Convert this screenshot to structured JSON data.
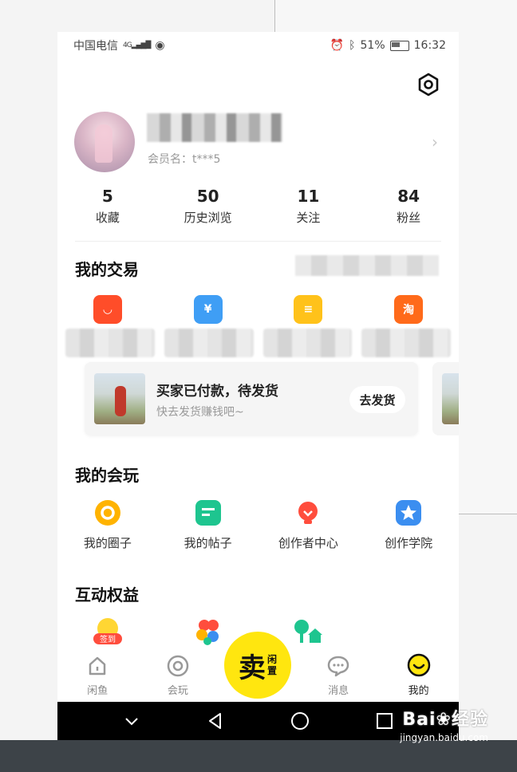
{
  "window": {
    "minimize_glyph": "—",
    "maximize_glyph": "☐",
    "close_glyph": "✕"
  },
  "status_bar": {
    "carrier": "中国电信",
    "network": "4G",
    "battery": "51%",
    "time": "16:32"
  },
  "profile": {
    "member_label": "会员名：t***5",
    "arrow_glyph": "›"
  },
  "stats": [
    {
      "value": "5",
      "label": "收藏"
    },
    {
      "value": "50",
      "label": "历史浏览"
    },
    {
      "value": "11",
      "label": "关注"
    },
    {
      "value": "84",
      "label": "粉丝"
    }
  ],
  "trade": {
    "title": "我的交易",
    "icons": [
      {
        "name": "bag-icon",
        "color": "#ff4d29",
        "glyph": "◡"
      },
      {
        "name": "yuan-icon",
        "color": "#3f9ef5",
        "glyph": "¥"
      },
      {
        "name": "note-icon",
        "color": "#ffc21a",
        "glyph": "≡"
      },
      {
        "name": "box-icon",
        "color": "#ff6a1a",
        "glyph": "淘"
      }
    ]
  },
  "order_card": {
    "title": "买家已付款，待发货",
    "subtitle": "快去发货赚钱吧~",
    "button": "去发货"
  },
  "play": {
    "title": "我的会玩",
    "items": [
      {
        "label": "我的圈子",
        "icon": "circle-icon",
        "color": "#ffb300"
      },
      {
        "label": "我的帖子",
        "icon": "post-icon",
        "color": "#1ec58f"
      },
      {
        "label": "创作者中心",
        "icon": "bulb-icon",
        "color": "#ff4d3d"
      },
      {
        "label": "创作学院",
        "icon": "star-icon",
        "color": "#3b8ef0"
      }
    ]
  },
  "rights": {
    "title": "互动权益",
    "checkin_badge": "签到"
  },
  "tabbar": {
    "home": "闲鱼",
    "play": "会玩",
    "sell_main": "卖",
    "sell_sub1": "闲",
    "sell_sub2": "置",
    "messages": "消息",
    "mine": "我的"
  },
  "watermark": {
    "brand": "Bai❀经验",
    "url": "jingyan.baidu.com"
  }
}
